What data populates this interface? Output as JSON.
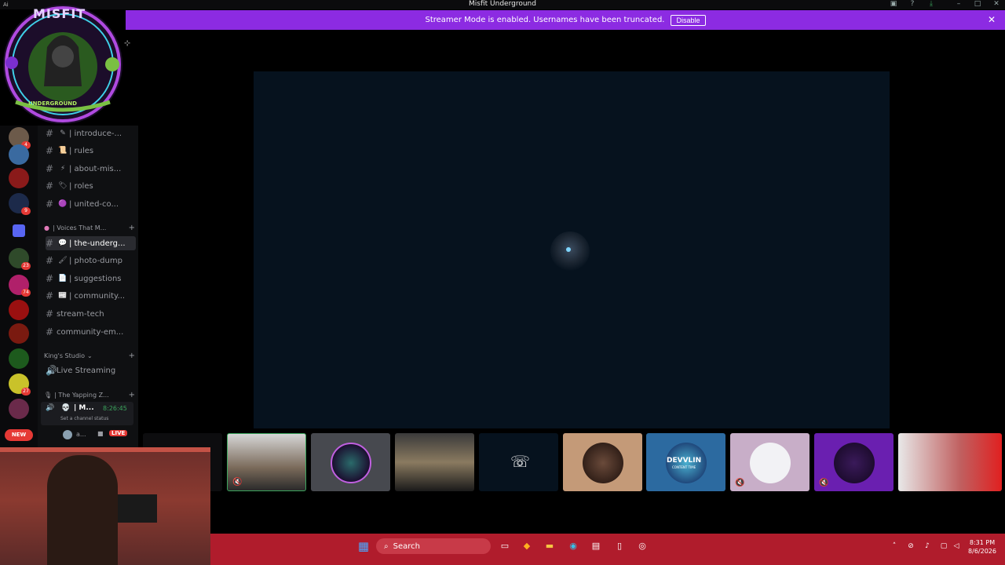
{
  "window": {
    "title": "Misfit Underground",
    "ai_label": "Ai"
  },
  "banner": {
    "message": "Streamer Mode is enabled. Usernames have been truncated.",
    "disable_label": "Disable"
  },
  "server": {
    "logo_text_top": "MISFIT",
    "logo_text_bottom": "UNDERGROUND"
  },
  "server_rail": {
    "badges": [
      "4",
      "9",
      "23",
      "74",
      "27"
    ],
    "new_label": "NEW"
  },
  "channels": {
    "top": [
      {
        "emoji": "✎",
        "name": "| introduce-..."
      },
      {
        "emoji": "📜",
        "name": "| rules"
      },
      {
        "emoji": "⚡",
        "name": "| about-mis..."
      },
      {
        "emoji": "🏷",
        "name": "| roles"
      },
      {
        "emoji": "🟣",
        "name": "| united-co..."
      }
    ],
    "category_voices": "| Voices That M...",
    "voices": [
      {
        "emoji": "💬",
        "name": "| the-underg...",
        "active": true
      },
      {
        "emoji": "🖌",
        "name": "| photo-dump"
      },
      {
        "emoji": "📄",
        "name": "| suggestions"
      },
      {
        "emoji": "📰",
        "name": "| community..."
      },
      {
        "emoji": "",
        "name": "stream-tech"
      },
      {
        "emoji": "",
        "name": "community-em..."
      }
    ],
    "category_kings": "King's Studio",
    "live_streaming": "Live Streaming",
    "category_yapping": "| The Yapping Z..."
  },
  "user_panel": {
    "name": "| M...",
    "timer": "8:26:45",
    "status": "Set a channel status",
    "bottom_name": "a...",
    "live_label": "LIVE"
  },
  "taskbar": {
    "search_placeholder": "Search",
    "time": "8:31 PM",
    "date": "8/6/2026"
  },
  "participants": {
    "devvlin_text": "DEVVLIN",
    "devvlin_sub": "CONTENT TIME"
  },
  "colors": {
    "banner": "#8c2be2",
    "taskbar": "#b01c2c",
    "stage": "#06121e",
    "live": "#e53935"
  }
}
